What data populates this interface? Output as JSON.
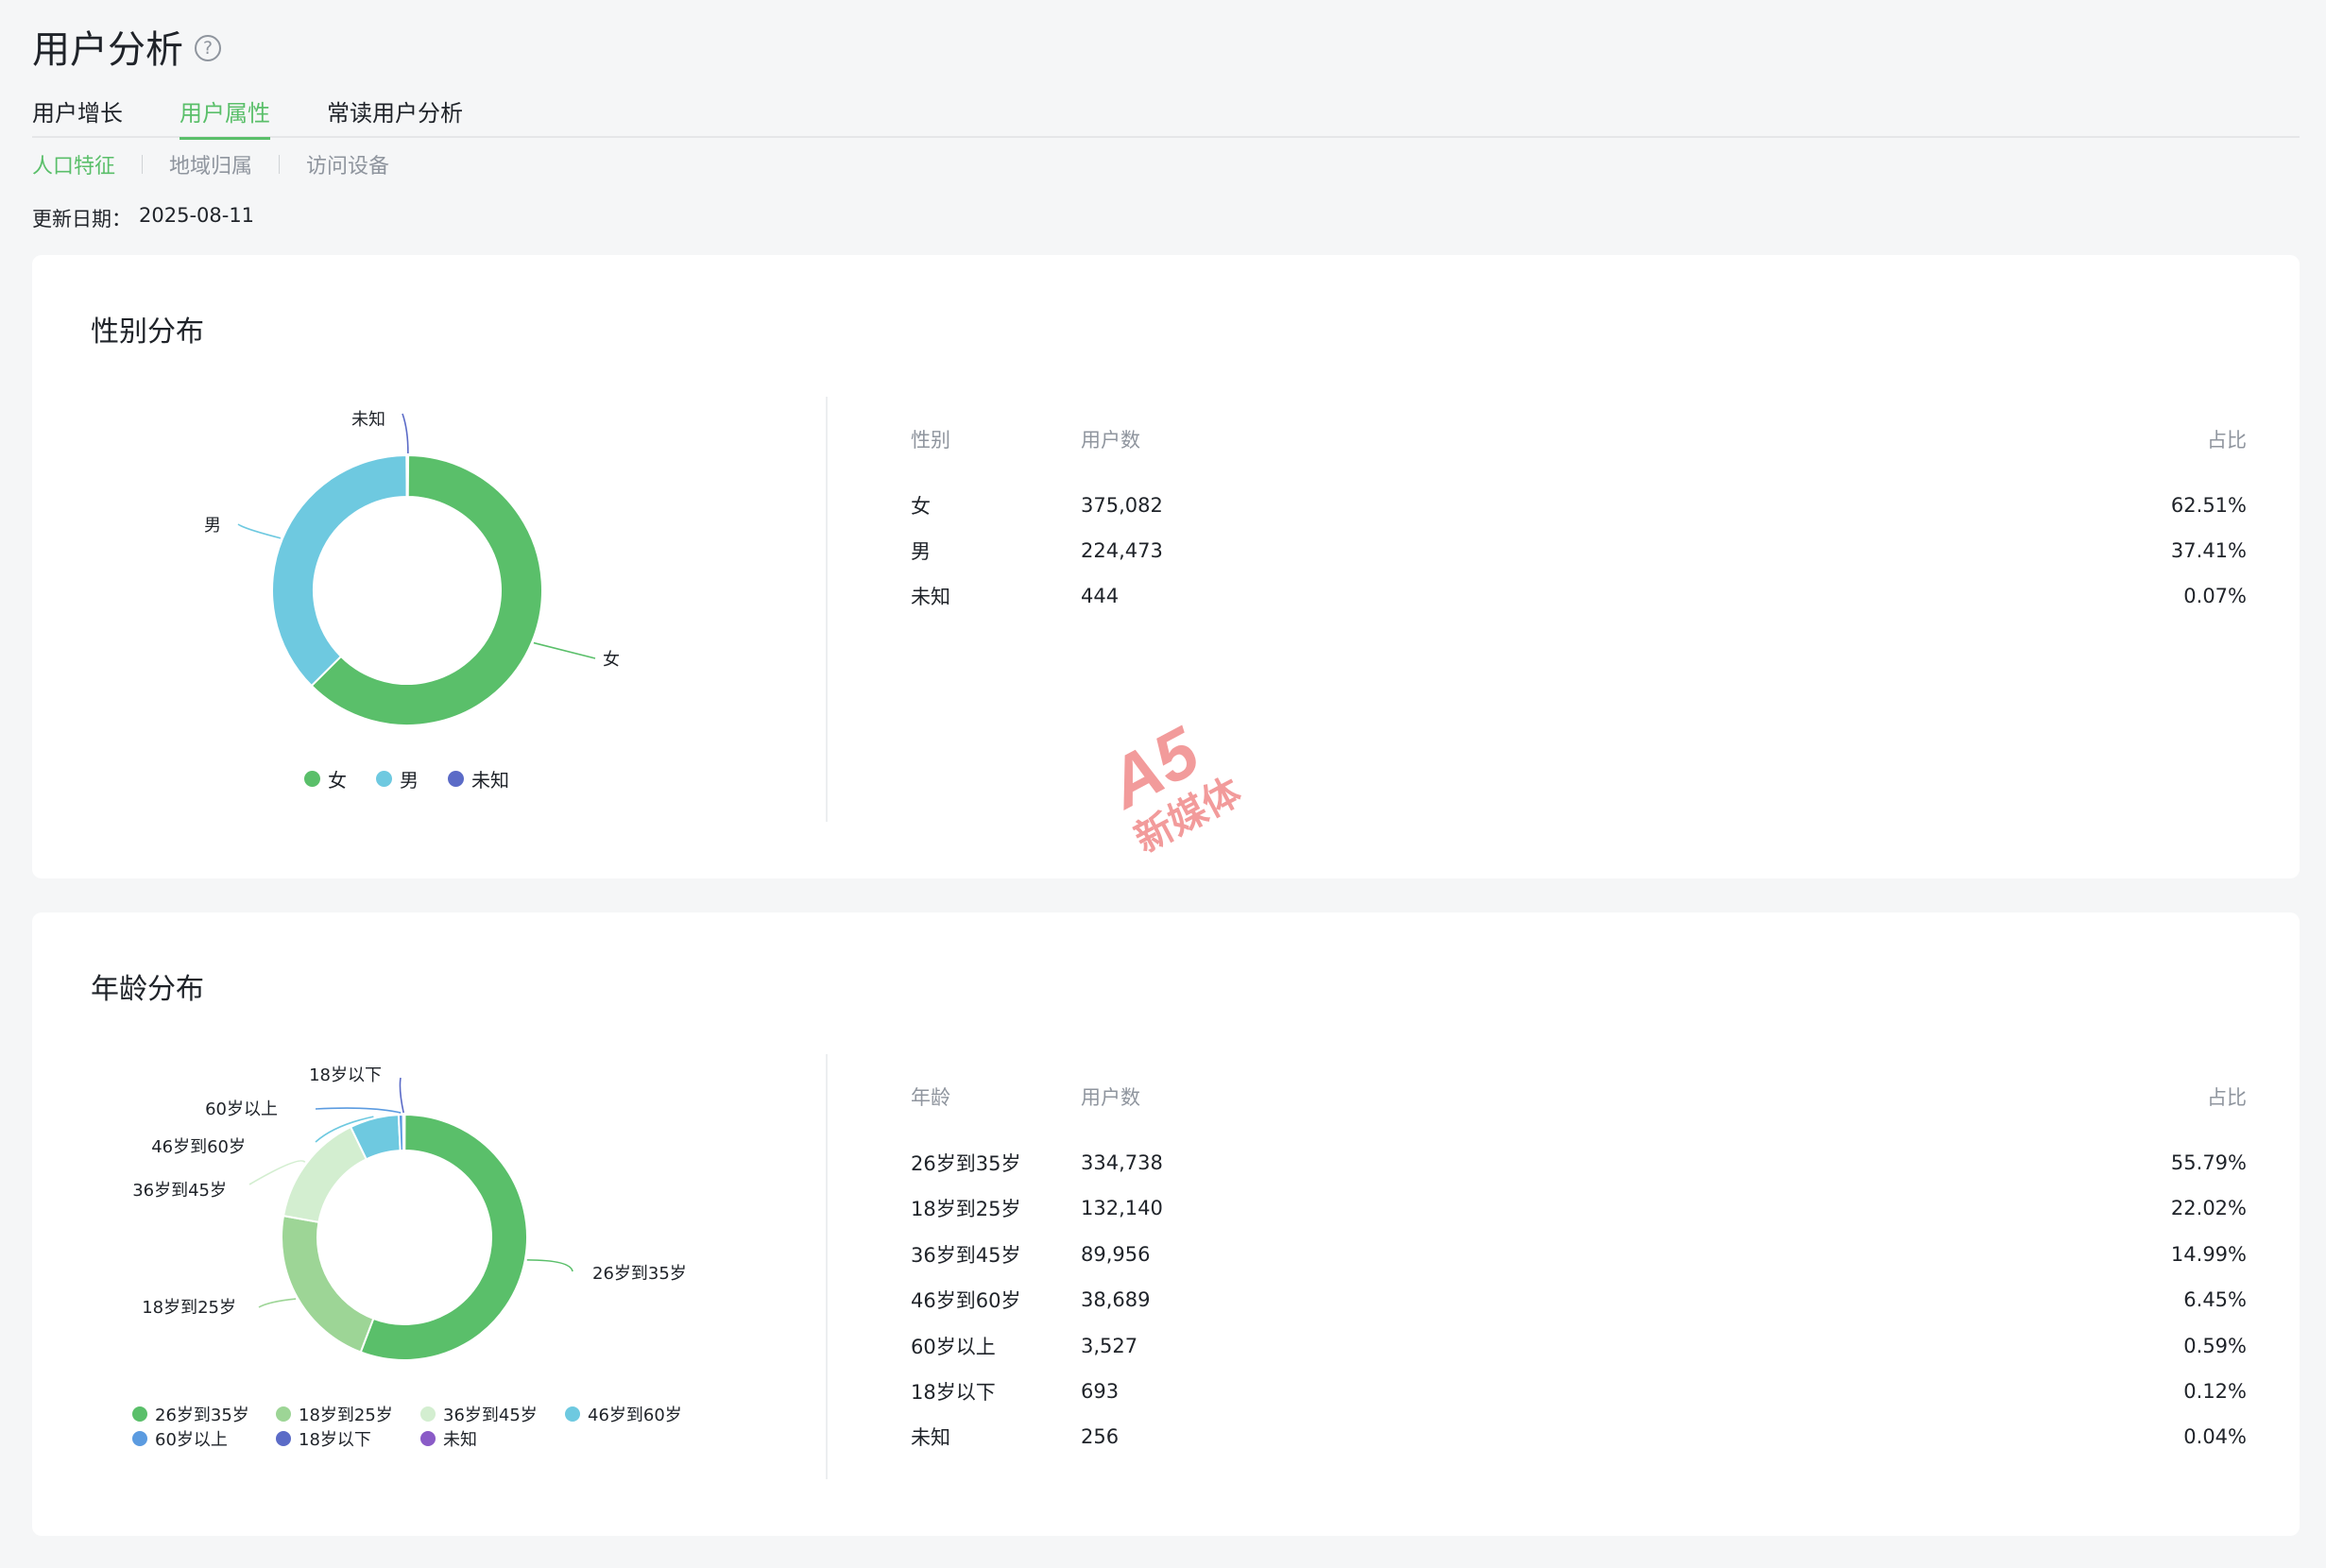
{
  "page": {
    "title": "用户分析",
    "help_icon": "?"
  },
  "tabs": [
    {
      "label": "用户增长",
      "active": false
    },
    {
      "label": "用户属性",
      "active": true
    },
    {
      "label": "常读用户分析",
      "active": false
    }
  ],
  "subtabs": [
    {
      "label": "人口特征",
      "active": true
    },
    {
      "label": "地域归属",
      "active": false
    },
    {
      "label": "访问设备",
      "active": false
    }
  ],
  "update": {
    "label": "更新日期：",
    "value": "2025-08-11"
  },
  "gender": {
    "title": "性别分布",
    "headers": [
      "性别",
      "用户数",
      "占比"
    ],
    "rows": [
      {
        "name": "女",
        "count": "375,082",
        "pct": "62.51%"
      },
      {
        "name": "男",
        "count": "224,473",
        "pct": "37.41%"
      },
      {
        "name": "未知",
        "count": "444",
        "pct": "0.07%"
      }
    ],
    "legend": [
      "女",
      "男",
      "未知"
    ]
  },
  "age": {
    "title": "年龄分布",
    "headers": [
      "年龄",
      "用户数",
      "占比"
    ],
    "rows": [
      {
        "name": "26岁到35岁",
        "count": "334,738",
        "pct": "55.79%"
      },
      {
        "name": "18岁到25岁",
        "count": "132,140",
        "pct": "22.02%"
      },
      {
        "name": "36岁到45岁",
        "count": "89,956",
        "pct": "14.99%"
      },
      {
        "name": "46岁到60岁",
        "count": "38,689",
        "pct": "6.45%"
      },
      {
        "name": "60岁以上",
        "count": "3,527",
        "pct": "0.59%"
      },
      {
        "name": "18岁以下",
        "count": "693",
        "pct": "0.12%"
      },
      {
        "name": "未知",
        "count": "256",
        "pct": "0.04%"
      }
    ],
    "legend": [
      "26岁到35岁",
      "18岁到25岁",
      "36岁到45岁",
      "46岁到60岁",
      "60岁以上",
      "18岁以下",
      "未知"
    ]
  },
  "watermark": {
    "text_top": "A5",
    "text_bottom": "新媒体"
  },
  "colors": {
    "accent": "#5abf6a",
    "女": "#5abf6a",
    "男": "#6ec9e0",
    "未知_gender": "#5b6bc7",
    "26岁到35岁": "#5abf6a",
    "18岁到25岁": "#9dd596",
    "36岁到45岁": "#d3eed0",
    "46岁到60岁": "#6ec9e0",
    "60岁以上": "#5b9be0",
    "18岁以下": "#5b6bc7",
    "未知_age": "#8a5bc7"
  },
  "chart_data": [
    {
      "type": "pie",
      "title": "性别分布",
      "categories": [
        "女",
        "男",
        "未知"
      ],
      "values": [
        62.51,
        37.41,
        0.07
      ]
    },
    {
      "type": "pie",
      "title": "年龄分布",
      "categories": [
        "26岁到35岁",
        "18岁到25岁",
        "36岁到45岁",
        "46岁到60岁",
        "60岁以上",
        "18岁以下",
        "未知"
      ],
      "values": [
        55.79,
        22.02,
        14.99,
        6.45,
        0.59,
        0.12,
        0.04
      ]
    }
  ]
}
